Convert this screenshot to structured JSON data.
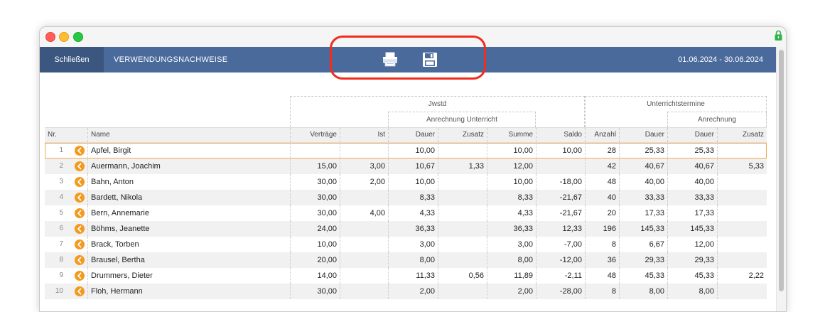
{
  "toolbar": {
    "close_label": "Schließen",
    "title": "VERWENDUNGSNACHWEISE",
    "date_range": "01.06.2024 - 30.06.2024"
  },
  "header_groups": {
    "jwstd": "Jwstd",
    "anrechnung_unterricht": "Anrechnung Unterricht",
    "unterrichtstermine": "Unterrichtstermine",
    "anrechnung": "Anrechnung"
  },
  "columns": [
    "Nr.",
    "Name",
    "Verträge",
    "Ist",
    "Dauer",
    "Zusatz",
    "Summe",
    "Saldo",
    "Anzahl",
    "Dauer",
    "Dauer",
    "Zusatz"
  ],
  "rows": [
    {
      "nr": "1",
      "name": "Apfel, Birgit",
      "vertraege": "",
      "ist": "",
      "dauer": "10,00",
      "zusatz": "",
      "summe": "10,00",
      "saldo": "10,00",
      "anzahl": "28",
      "t_dauer": "25,33",
      "a_dauer": "25,33",
      "a_zusatz": ""
    },
    {
      "nr": "2",
      "name": "Auermann, Joachim",
      "vertraege": "15,00",
      "ist": "3,00",
      "dauer": "10,67",
      "zusatz": "1,33",
      "summe": "12,00",
      "saldo": "",
      "anzahl": "42",
      "t_dauer": "40,67",
      "a_dauer": "40,67",
      "a_zusatz": "5,33"
    },
    {
      "nr": "3",
      "name": "Bahn, Anton",
      "vertraege": "30,00",
      "ist": "2,00",
      "dauer": "10,00",
      "zusatz": "",
      "summe": "10,00",
      "saldo": "-18,00",
      "anzahl": "48",
      "t_dauer": "40,00",
      "a_dauer": "40,00",
      "a_zusatz": ""
    },
    {
      "nr": "4",
      "name": "Bardett, Nikola",
      "vertraege": "30,00",
      "ist": "",
      "dauer": "8,33",
      "zusatz": "",
      "summe": "8,33",
      "saldo": "-21,67",
      "anzahl": "40",
      "t_dauer": "33,33",
      "a_dauer": "33,33",
      "a_zusatz": ""
    },
    {
      "nr": "5",
      "name": "Bern, Annemarie",
      "vertraege": "30,00",
      "ist": "4,00",
      "dauer": "4,33",
      "zusatz": "",
      "summe": "4,33",
      "saldo": "-21,67",
      "anzahl": "20",
      "t_dauer": "17,33",
      "a_dauer": "17,33",
      "a_zusatz": ""
    },
    {
      "nr": "6",
      "name": "Böhms, Jeanette",
      "vertraege": "24,00",
      "ist": "",
      "dauer": "36,33",
      "zusatz": "",
      "summe": "36,33",
      "saldo": "12,33",
      "anzahl": "196",
      "t_dauer": "145,33",
      "a_dauer": "145,33",
      "a_zusatz": ""
    },
    {
      "nr": "7",
      "name": "Brack, Torben",
      "vertraege": "10,00",
      "ist": "",
      "dauer": "3,00",
      "zusatz": "",
      "summe": "3,00",
      "saldo": "-7,00",
      "anzahl": "8",
      "t_dauer": "6,67",
      "a_dauer": "12,00",
      "a_zusatz": ""
    },
    {
      "nr": "8",
      "name": "Brausel, Bertha",
      "vertraege": "20,00",
      "ist": "",
      "dauer": "8,00",
      "zusatz": "",
      "summe": "8,00",
      "saldo": "-12,00",
      "anzahl": "36",
      "t_dauer": "29,33",
      "a_dauer": "29,33",
      "a_zusatz": ""
    },
    {
      "nr": "9",
      "name": "Drummers, Dieter",
      "vertraege": "14,00",
      "ist": "",
      "dauer": "11,33",
      "zusatz": "0,56",
      "summe": "11,89",
      "saldo": "-2,11",
      "anzahl": "48",
      "t_dauer": "45,33",
      "a_dauer": "45,33",
      "a_zusatz": "2,22"
    },
    {
      "nr": "10",
      "name": "Floh, Hermann",
      "vertraege": "30,00",
      "ist": "",
      "dauer": "2,00",
      "zusatz": "",
      "summe": "2,00",
      "saldo": "-28,00",
      "anzahl": "8",
      "t_dauer": "8,00",
      "a_dauer": "8,00",
      "a_zusatz": ""
    }
  ],
  "colors": {
    "toolbar": "#4a6a9c",
    "close_button": "#3b577f",
    "highlight": "#f22c1c",
    "arrow": "#f39a1e",
    "selected_row_border": "#f3a64a"
  },
  "icons": {
    "print": "printer-icon",
    "save": "floppy-disk-icon",
    "row_action": "arrow-left-circle-icon",
    "security": "lock-icon"
  }
}
